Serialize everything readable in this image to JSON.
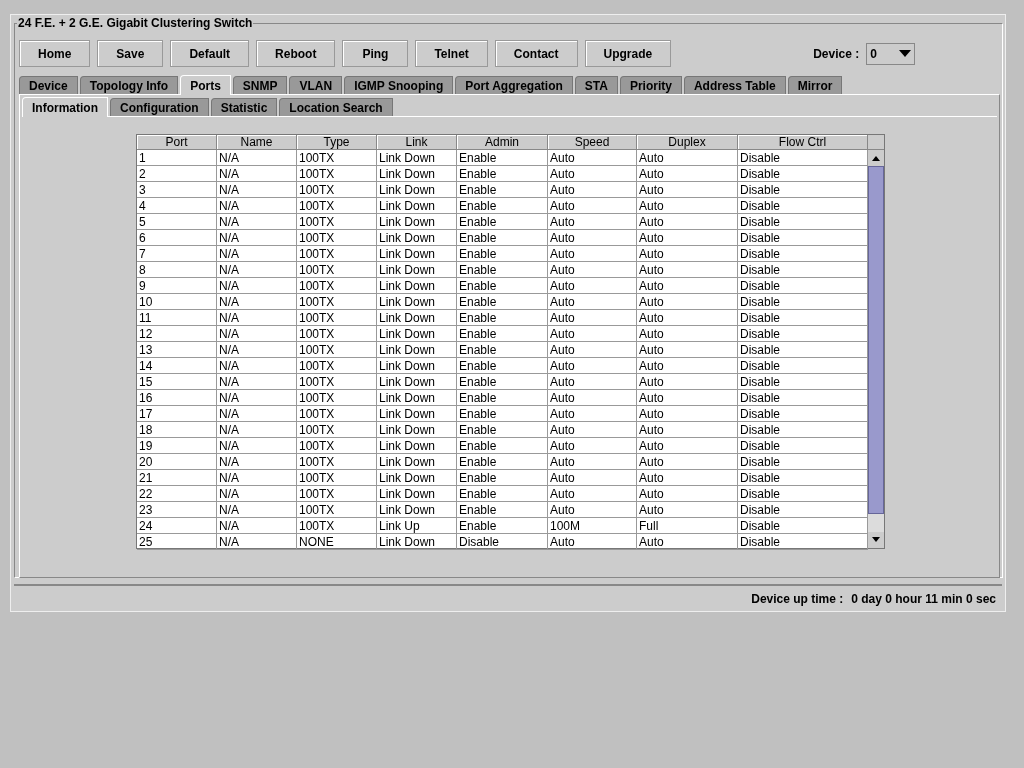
{
  "panel": {
    "title": "24 F.E. + 2 G.E. Gigabit Clustering Switch"
  },
  "toolbar": {
    "buttons": [
      "Home",
      "Save",
      "Default",
      "Reboot",
      "Ping",
      "Telnet",
      "Contact",
      "Upgrade"
    ],
    "device_label": "Device :",
    "device_value": "0"
  },
  "tabs": [
    {
      "label": "Device",
      "selected": false
    },
    {
      "label": "Topology Info",
      "selected": false
    },
    {
      "label": "Ports",
      "selected": true
    },
    {
      "label": "SNMP",
      "selected": false
    },
    {
      "label": "VLAN",
      "selected": false
    },
    {
      "label": "IGMP Snooping",
      "selected": false
    },
    {
      "label": "Port Aggregation",
      "selected": false
    },
    {
      "label": "STA",
      "selected": false
    },
    {
      "label": "Priority",
      "selected": false
    },
    {
      "label": "Address Table",
      "selected": false
    },
    {
      "label": "Mirror",
      "selected": false
    }
  ],
  "subtabs": [
    {
      "label": "Information",
      "selected": true
    },
    {
      "label": "Configuration",
      "selected": false
    },
    {
      "label": "Statistic",
      "selected": false
    },
    {
      "label": "Location Search",
      "selected": false
    }
  ],
  "table": {
    "columns": [
      "Port",
      "Name",
      "Type",
      "Link",
      "Admin",
      "Speed",
      "Duplex",
      "Flow Ctrl"
    ],
    "rows": [
      [
        "1",
        "N/A",
        "100TX",
        "Link Down",
        "Enable",
        "Auto",
        "Auto",
        "Disable"
      ],
      [
        "2",
        "N/A",
        "100TX",
        "Link Down",
        "Enable",
        "Auto",
        "Auto",
        "Disable"
      ],
      [
        "3",
        "N/A",
        "100TX",
        "Link Down",
        "Enable",
        "Auto",
        "Auto",
        "Disable"
      ],
      [
        "4",
        "N/A",
        "100TX",
        "Link Down",
        "Enable",
        "Auto",
        "Auto",
        "Disable"
      ],
      [
        "5",
        "N/A",
        "100TX",
        "Link Down",
        "Enable",
        "Auto",
        "Auto",
        "Disable"
      ],
      [
        "6",
        "N/A",
        "100TX",
        "Link Down",
        "Enable",
        "Auto",
        "Auto",
        "Disable"
      ],
      [
        "7",
        "N/A",
        "100TX",
        "Link Down",
        "Enable",
        "Auto",
        "Auto",
        "Disable"
      ],
      [
        "8",
        "N/A",
        "100TX",
        "Link Down",
        "Enable",
        "Auto",
        "Auto",
        "Disable"
      ],
      [
        "9",
        "N/A",
        "100TX",
        "Link Down",
        "Enable",
        "Auto",
        "Auto",
        "Disable"
      ],
      [
        "10",
        "N/A",
        "100TX",
        "Link Down",
        "Enable",
        "Auto",
        "Auto",
        "Disable"
      ],
      [
        "11",
        "N/A",
        "100TX",
        "Link Down",
        "Enable",
        "Auto",
        "Auto",
        "Disable"
      ],
      [
        "12",
        "N/A",
        "100TX",
        "Link Down",
        "Enable",
        "Auto",
        "Auto",
        "Disable"
      ],
      [
        "13",
        "N/A",
        "100TX",
        "Link Down",
        "Enable",
        "Auto",
        "Auto",
        "Disable"
      ],
      [
        "14",
        "N/A",
        "100TX",
        "Link Down",
        "Enable",
        "Auto",
        "Auto",
        "Disable"
      ],
      [
        "15",
        "N/A",
        "100TX",
        "Link Down",
        "Enable",
        "Auto",
        "Auto",
        "Disable"
      ],
      [
        "16",
        "N/A",
        "100TX",
        "Link Down",
        "Enable",
        "Auto",
        "Auto",
        "Disable"
      ],
      [
        "17",
        "N/A",
        "100TX",
        "Link Down",
        "Enable",
        "Auto",
        "Auto",
        "Disable"
      ],
      [
        "18",
        "N/A",
        "100TX",
        "Link Down",
        "Enable",
        "Auto",
        "Auto",
        "Disable"
      ],
      [
        "19",
        "N/A",
        "100TX",
        "Link Down",
        "Enable",
        "Auto",
        "Auto",
        "Disable"
      ],
      [
        "20",
        "N/A",
        "100TX",
        "Link Down",
        "Enable",
        "Auto",
        "Auto",
        "Disable"
      ],
      [
        "21",
        "N/A",
        "100TX",
        "Link Down",
        "Enable",
        "Auto",
        "Auto",
        "Disable"
      ],
      [
        "22",
        "N/A",
        "100TX",
        "Link Down",
        "Enable",
        "Auto",
        "Auto",
        "Disable"
      ],
      [
        "23",
        "N/A",
        "100TX",
        "Link Down",
        "Enable",
        "Auto",
        "Auto",
        "Disable"
      ],
      [
        "24",
        "N/A",
        "100TX",
        "Link Up",
        "Enable",
        "100M",
        "Full",
        "Disable"
      ],
      [
        "25",
        "N/A",
        "NONE",
        "Link Down",
        "Disable",
        "Auto",
        "Auto",
        "Disable"
      ]
    ]
  },
  "status_bar": {
    "label": "Device up time :",
    "value": "0 day 0 hour 11 min 0 sec"
  }
}
